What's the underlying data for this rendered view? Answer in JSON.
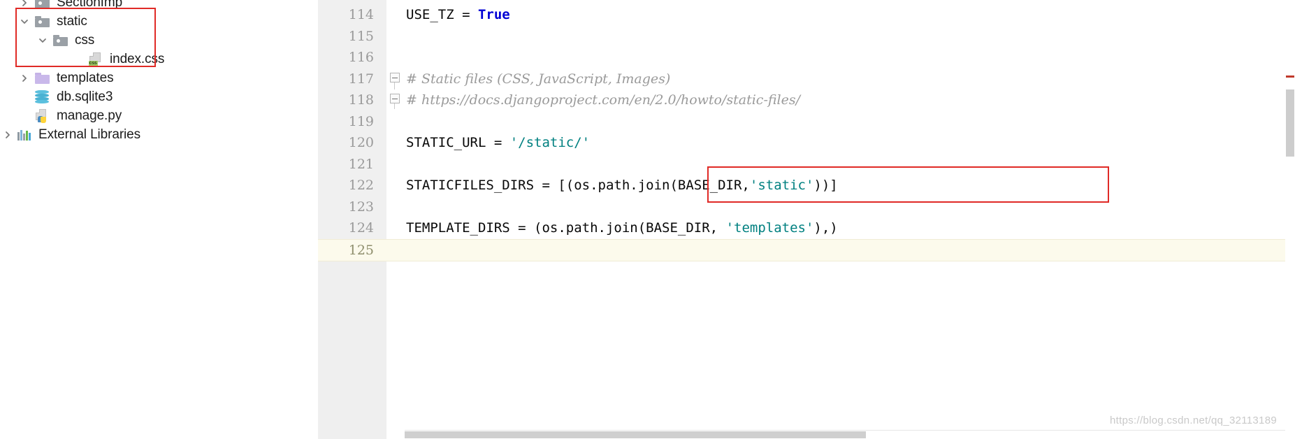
{
  "project_tree": {
    "name": "project-explorer",
    "items": [
      {
        "label": "SectionImp",
        "icon": "folder-gray-icon",
        "arrow": "chevron-right",
        "indent": 0,
        "clipped_top": true
      },
      {
        "label": "static",
        "icon": "folder-gray-icon",
        "arrow": "chevron-down",
        "indent": 0
      },
      {
        "label": "css",
        "icon": "folder-gray-icon",
        "arrow": "chevron-down",
        "indent": 1
      },
      {
        "label": "index.css",
        "icon": "css-file-icon",
        "arrow": "none",
        "indent": 2
      },
      {
        "label": "templates",
        "icon": "folder-purple-icon",
        "arrow": "chevron-right",
        "indent": 0
      },
      {
        "label": "db.sqlite3",
        "icon": "sqlite-db-icon",
        "arrow": "none",
        "indent": 0
      },
      {
        "label": "manage.py",
        "icon": "python-file-icon",
        "arrow": "none",
        "indent": 0
      },
      {
        "label": "External Libraries",
        "icon": "external-libraries-icon",
        "arrow": "chevron-right",
        "indent": -1
      }
    ],
    "highlight_note": "red annotation box around static / css / index.css"
  },
  "editor": {
    "name": "code-editor",
    "current_line": 125,
    "lines": [
      {
        "number": "114",
        "segments": [
          {
            "t": "USE_TZ = ",
            "c": "plain"
          },
          {
            "t": "True",
            "c": "kw-true"
          }
        ]
      },
      {
        "number": "115",
        "segments": [
          {
            "t": "",
            "c": "plain"
          }
        ]
      },
      {
        "number": "116",
        "segments": [
          {
            "t": "",
            "c": "plain"
          }
        ]
      },
      {
        "number": "117",
        "segments": [
          {
            "t": "# Static files (CSS, JavaScript, Images)",
            "c": "comment"
          }
        ],
        "fold": "start"
      },
      {
        "number": "118",
        "segments": [
          {
            "t": "# https://docs.djangoproject.com/en/2.0/howto/static-files/",
            "c": "comment"
          }
        ],
        "fold": "end"
      },
      {
        "number": "119",
        "segments": [
          {
            "t": "",
            "c": "plain"
          }
        ]
      },
      {
        "number": "120",
        "segments": [
          {
            "t": "STATIC_URL = ",
            "c": "plain"
          },
          {
            "t": "'/static/'",
            "c": "str"
          }
        ]
      },
      {
        "number": "121",
        "segments": [
          {
            "t": "",
            "c": "plain"
          }
        ]
      },
      {
        "number": "122",
        "segments": [
          {
            "t": "STATICFILES_DIRS = [(os.path.join(BASE_DIR,",
            "c": "plain"
          },
          {
            "t": "'static'",
            "c": "str"
          },
          {
            "t": "))]",
            "c": "plain"
          }
        ]
      },
      {
        "number": "123",
        "segments": [
          {
            "t": "",
            "c": "plain"
          }
        ]
      },
      {
        "number": "124",
        "segments": [
          {
            "t": "TEMPLATE_DIRS = (os.path.join(BASE_DIR, ",
            "c": "plain"
          },
          {
            "t": "'templates'",
            "c": "str"
          },
          {
            "t": "),)",
            "c": "plain"
          }
        ]
      },
      {
        "number": "125",
        "segments": [
          {
            "t": "",
            "c": "plain"
          }
        ],
        "current": true
      }
    ],
    "highlight_note": "red annotation box around line 122 STATICFILES_DIRS"
  },
  "watermark": {
    "text": "https://blog.csdn.net/qq_32113189"
  },
  "colors": {
    "annotation_red": "#e02a26",
    "keyword_blue": "#0000d4",
    "string_teal": "#008080",
    "comment_gray": "#9a9a9a",
    "gutter_bg": "#f0f0f0",
    "current_line_bg": "#fcfaec",
    "folder_gray": "#9aa0a6",
    "folder_purple": "#c9b8ea",
    "sqlite_blue": "#49b2d3",
    "python_blue": "#4b8bbe",
    "python_yellow": "#ffd43b",
    "css_badge_green": "#a5d16b",
    "scrollbar_thumb": "#cdcdcd"
  }
}
